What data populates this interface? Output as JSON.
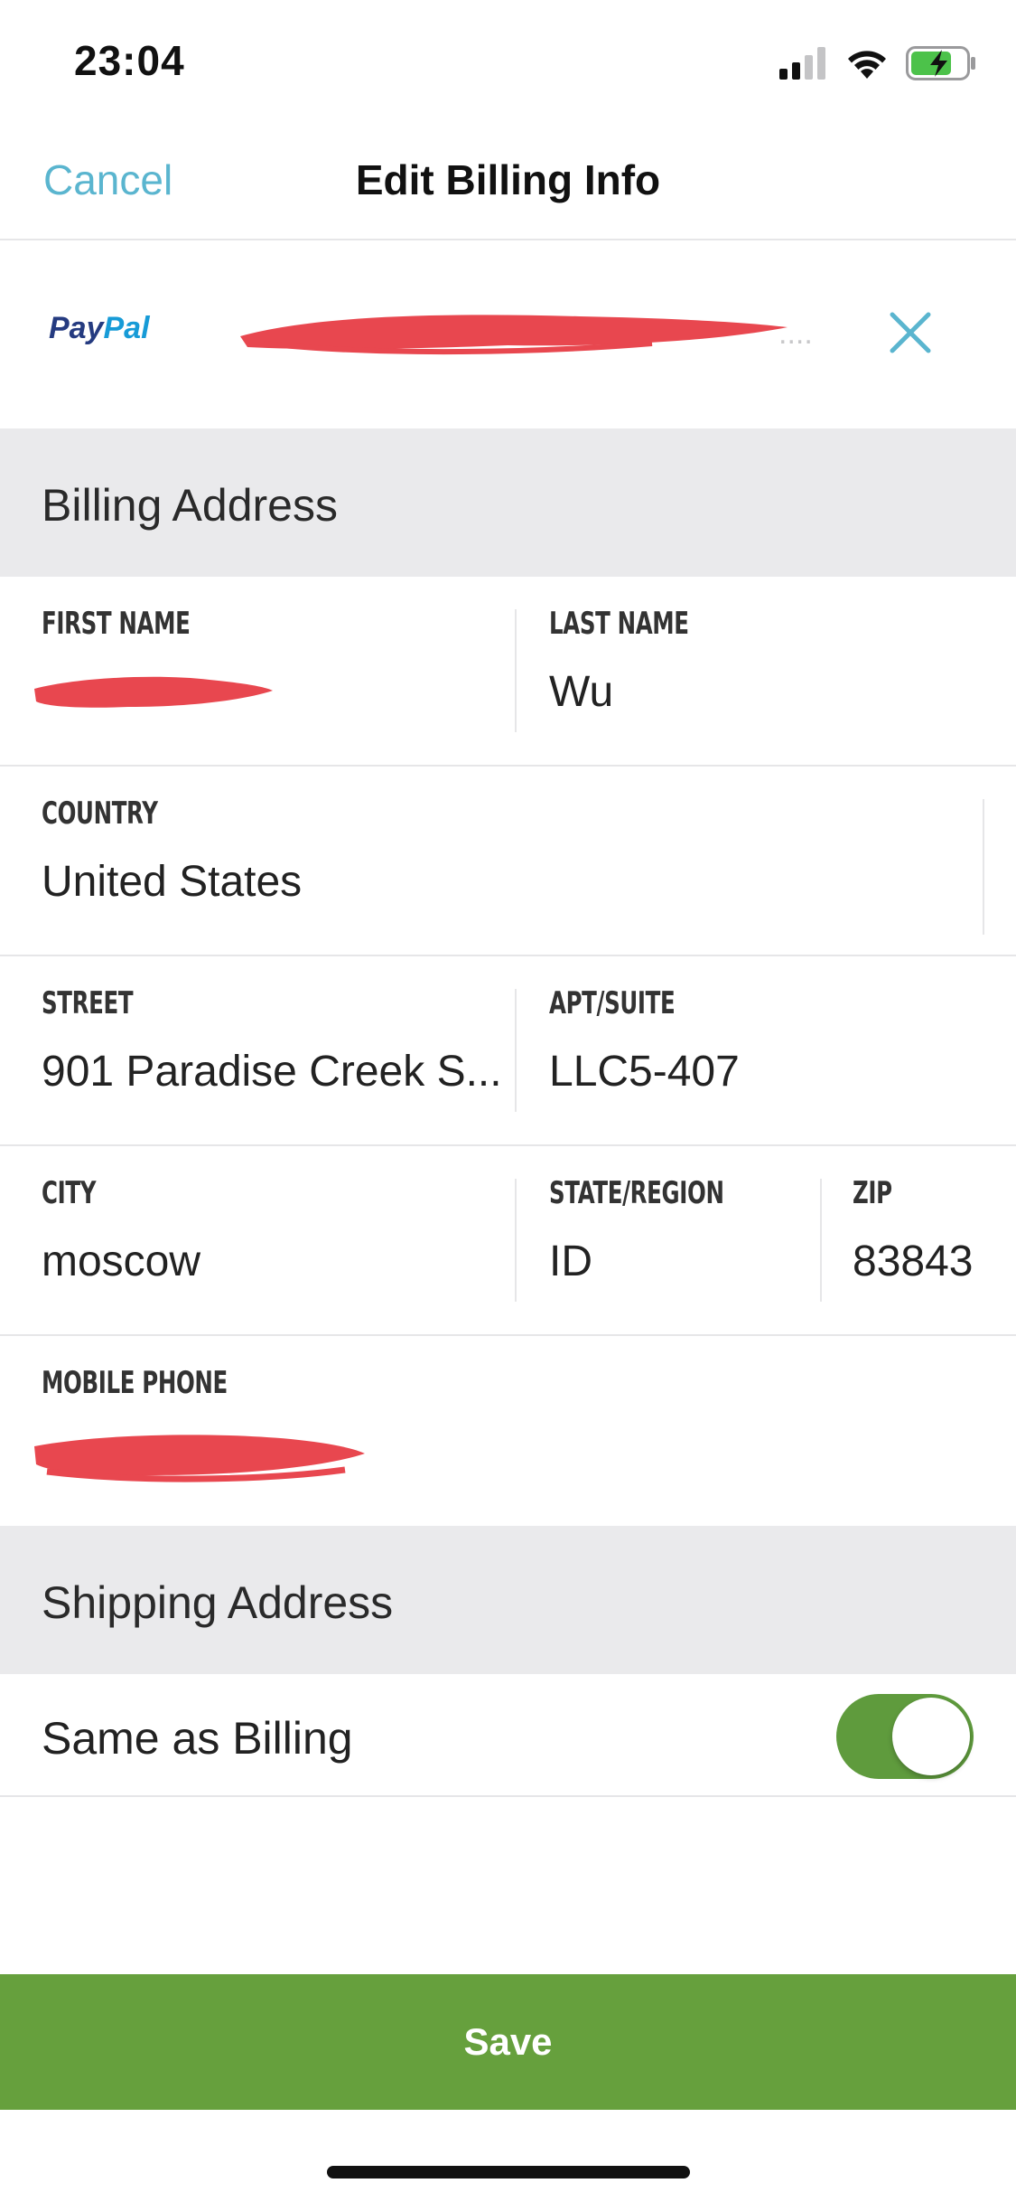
{
  "status_bar": {
    "time": "23:04",
    "icons": [
      "signal-icon",
      "wifi-icon",
      "battery-charging-icon"
    ],
    "battery_color": "#4cc24a"
  },
  "nav": {
    "cancel_label": "Cancel",
    "title": "Edit Billing Info"
  },
  "payment": {
    "brand_part1": "Pay",
    "brand_part2": "Pal",
    "account": "[redacted]",
    "close_icon": "close-icon"
  },
  "billing": {
    "header": "Billing Address",
    "first_name_label": "FIRST NAME",
    "first_name_value": "[redacted]",
    "last_name_label": "LAST NAME",
    "last_name_value": "Wu",
    "country_label": "COUNTRY",
    "country_value": "United States",
    "street_label": "STREET",
    "street_value": "901 Paradise Creek S...",
    "apt_label": "APT/SUITE",
    "apt_value": "LLC5-407",
    "city_label": "CITY",
    "city_value": "moscow",
    "state_label": "STATE/REGION",
    "state_value": "ID",
    "zip_label": "ZIP",
    "zip_value": "83843",
    "phone_label": "MOBILE PHONE",
    "phone_value": "[redacted]"
  },
  "shipping": {
    "header": "Shipping Address",
    "same_as_billing_label": "Same as Billing",
    "same_as_billing_on": true
  },
  "footer": {
    "save_label": "Save"
  },
  "colors": {
    "accent": "#5ab5cf",
    "primary_green": "#66a03d",
    "toggle_green": "#5f9b3d",
    "section_bg": "#eaeaec",
    "redaction": "#e8474f"
  }
}
